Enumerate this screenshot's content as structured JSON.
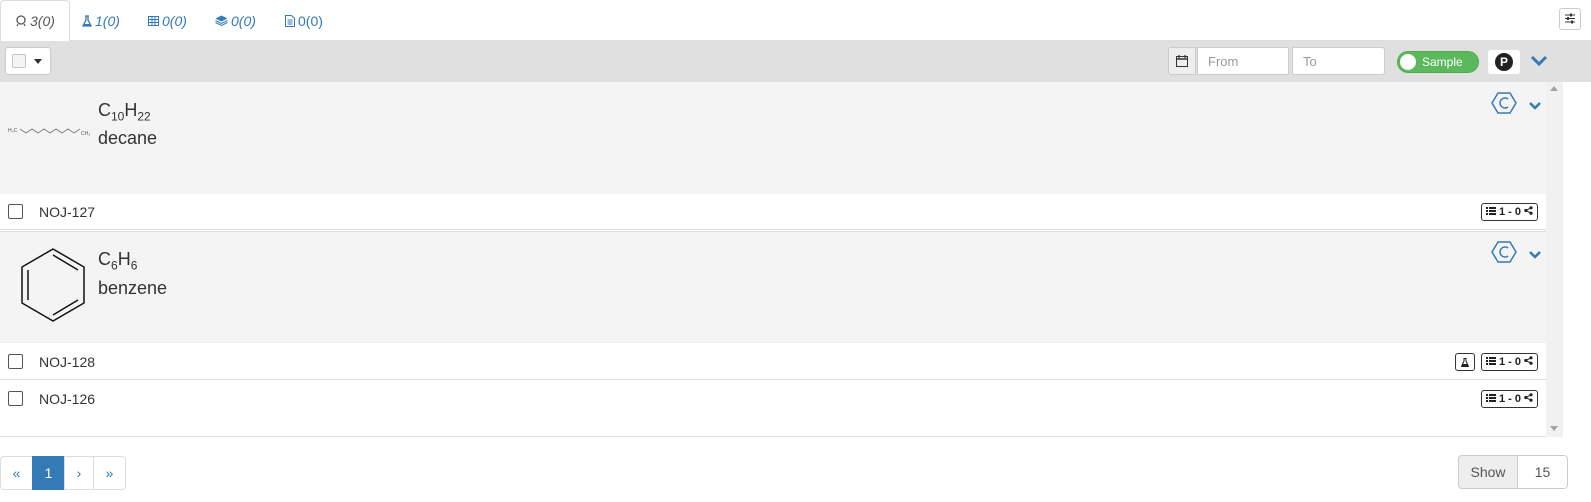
{
  "tabs": [
    {
      "icon": "sample-icon",
      "label": "3(0)",
      "active": true
    },
    {
      "icon": "flask-icon",
      "label": "1(0)",
      "active": false
    },
    {
      "icon": "wellplate-icon",
      "label": "0(0)",
      "active": false
    },
    {
      "icon": "layers-icon",
      "label": "0(0)",
      "active": false
    },
    {
      "icon": "document-icon",
      "label": "0(0)",
      "active": false
    }
  ],
  "toolbar": {
    "from_placeholder": "From",
    "to_placeholder": "To",
    "toggle_label": "Sample",
    "p_label": "P"
  },
  "molecules": [
    {
      "formula": {
        "elements": [
          {
            "sym": "C",
            "sub": "10"
          },
          {
            "sym": "H",
            "sub": "22"
          }
        ]
      },
      "name": "decane",
      "structure_labels": {
        "left": "H₃C",
        "right": "CH₃"
      },
      "samples": [
        {
          "name": "NOJ-127",
          "badge": "1 - 0",
          "has_user_icon": false
        }
      ]
    },
    {
      "formula": {
        "elements": [
          {
            "sym": "C",
            "sub": "6"
          },
          {
            "sym": "H",
            "sub": "6"
          }
        ]
      },
      "name": "benzene",
      "samples": [
        {
          "name": "NOJ-128",
          "badge": "1 - 0",
          "has_user_icon": true
        },
        {
          "name": "NOJ-126",
          "badge": "1 - 0",
          "has_user_icon": false
        }
      ]
    }
  ],
  "pagination": {
    "first": "«",
    "current": "1",
    "next": "›",
    "last": "»"
  },
  "show": {
    "label": "Show",
    "value": "15"
  },
  "colors": {
    "link": "#337ab7",
    "toolbar_bg": "#e0e0e0",
    "molecule_bg": "#f4f4f4",
    "toggle_green": "#5cb85c"
  }
}
